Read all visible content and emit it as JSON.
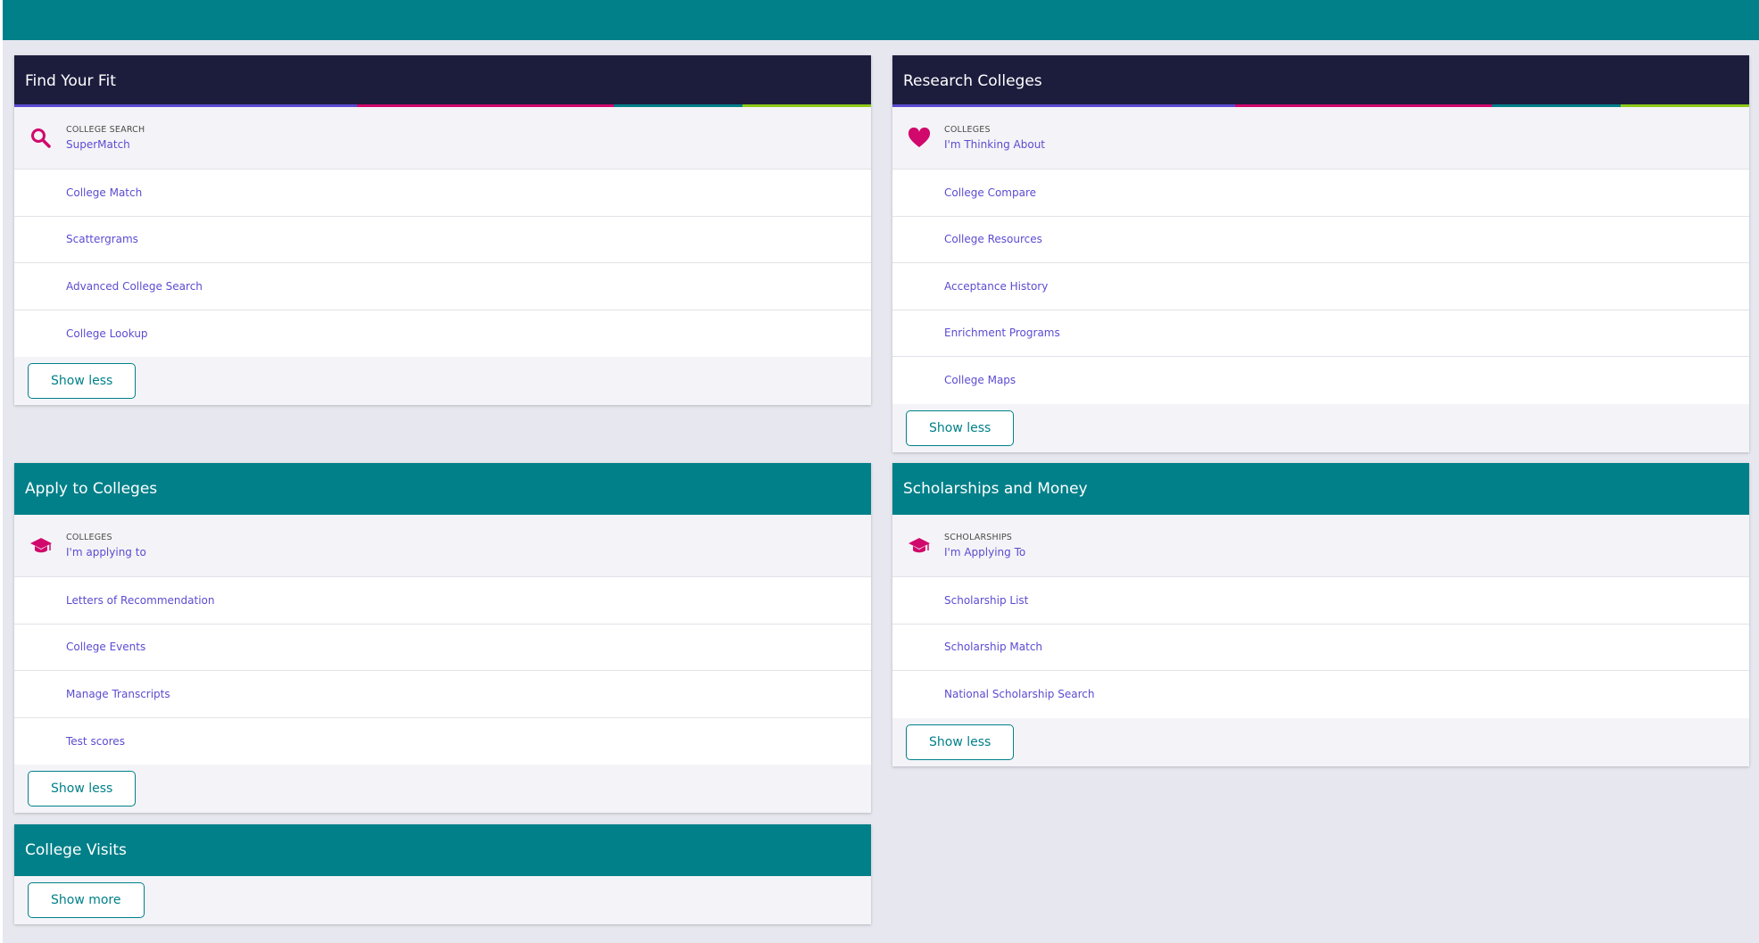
{
  "colors": {
    "topbar": "#018089",
    "dark_header": "#1c1d3d",
    "teal_header": "#018089",
    "link": "#5a4cd1",
    "icon": "#d1096c",
    "stripe": [
      "#5a4cd1",
      "#d1096c",
      "#018089",
      "#8ec919"
    ]
  },
  "cards": {
    "find_fit": {
      "title": "Find Your Fit",
      "featured": {
        "icon": "search-icon",
        "caption": "COLLEGE SEARCH",
        "link": "SuperMatch"
      },
      "items": [
        "College Match",
        "Scattergrams",
        "Advanced College Search",
        "College Lookup"
      ],
      "button": "Show less"
    },
    "research": {
      "title": "Research Colleges",
      "featured": {
        "icon": "heart-icon",
        "caption": "COLLEGES",
        "link": "I'm Thinking About"
      },
      "items": [
        "College Compare",
        "College Resources",
        "Acceptance History",
        "Enrichment Programs",
        "College Maps"
      ],
      "button": "Show less"
    },
    "apply": {
      "title": "Apply to Colleges",
      "featured": {
        "icon": "graduation-cap-icon",
        "caption": "COLLEGES",
        "link": "I'm applying to"
      },
      "items": [
        "Letters of Recommendation",
        "College Events",
        "Manage Transcripts",
        "Test scores"
      ],
      "button": "Show less"
    },
    "scholarships": {
      "title": "Scholarships and Money",
      "featured": {
        "icon": "graduation-cap-icon",
        "caption": "SCHOLARSHIPS",
        "link": "I'm Applying To"
      },
      "items": [
        "Scholarship List",
        "Scholarship Match",
        "National Scholarship Search"
      ],
      "button": "Show less"
    },
    "visits": {
      "title": "College Visits",
      "button": "Show more"
    }
  }
}
